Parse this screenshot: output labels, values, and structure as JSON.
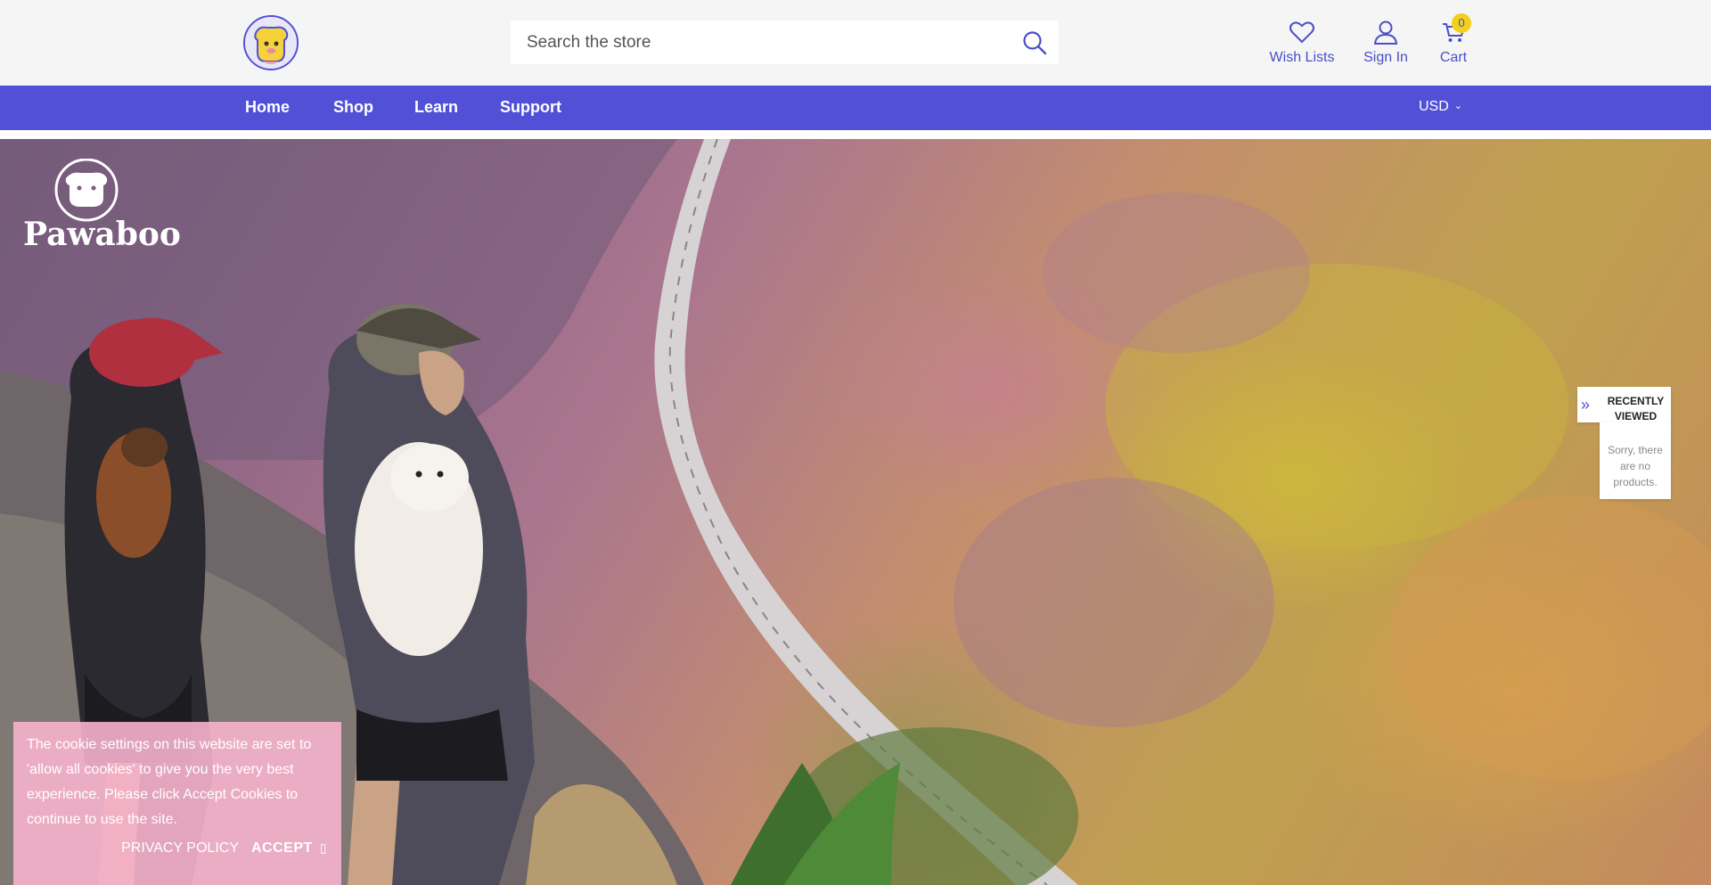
{
  "header": {
    "logo_alt": "Pawaboo",
    "search": {
      "placeholder": "Search the store"
    },
    "wishlist_label": "Wish Lists",
    "signin_label": "Sign In",
    "cart_label": "Cart",
    "cart_count": "0"
  },
  "nav": {
    "items": [
      {
        "label": "Home"
      },
      {
        "label": "Shop"
      },
      {
        "label": "Learn"
      },
      {
        "label": "Support"
      }
    ],
    "currency": "USD"
  },
  "hero": {
    "brand_text": "Pawaboo"
  },
  "recently_viewed": {
    "title_line1": "RECENTLY",
    "title_line2": "VIEWED",
    "empty_message": "Sorry, there are no products."
  },
  "cookie": {
    "message": "The cookie settings on this website are set to 'allow all cookies' to give you the very best experience. Please click Accept Cookies to continue to use the site.",
    "privacy_label": "PRIVACY POLICY",
    "accept_label": "ACCEPT"
  },
  "colors": {
    "brand": "#5150d6",
    "header_bg": "#f5f5f5",
    "badge": "#f2d01c",
    "cookie_bg": "#f6b2cc"
  }
}
